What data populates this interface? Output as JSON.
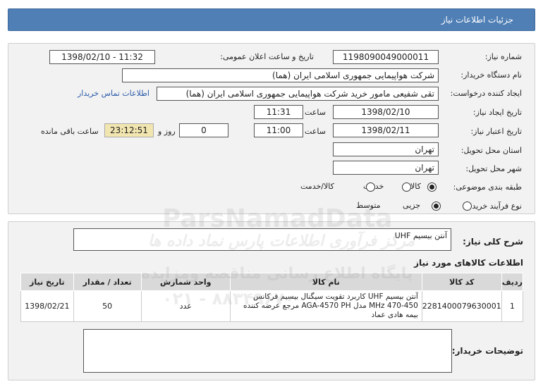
{
  "header": {
    "title": "جزئیات اطلاعات نیاز"
  },
  "form": {
    "need_number_label": "شماره نیاز:",
    "need_number": "1198090049000011",
    "announce_label": "تاریخ و ساعت اعلان عمومی:",
    "announce_value": "1398/02/10 - 11:32",
    "buyer_org_label": "نام دستگاه خریدار:",
    "buyer_org": "شرکت هواپیمایی جمهوری اسلامی ایران (هما)",
    "requester_label": "ایجاد کننده درخواست:",
    "requester": "تقی  شفیعی مامور خرید شرکت هواپیمایی جمهوری اسلامی ایران (هما)",
    "contact_link": "اطلاعات تماس خریدار",
    "create_date_label": "تاریخ ایجاد نیاز:",
    "create_date": "1398/02/10",
    "time_label": "ساعت",
    "create_time": "11:31",
    "valid_date_label": "تاریخ اعتبار نیاز:",
    "valid_date": "1398/02/11",
    "valid_time": "11:00",
    "days_label": "روز و",
    "days_value": "0",
    "remaining_time": "23:12:51",
    "remaining_label": "ساعت باقی مانده",
    "province_label": "استان محل تحویل:",
    "province": "تهران",
    "city_label": "شهر محل تحویل:",
    "city": "تهران",
    "category_label": "طبقه بندی موضوعی:",
    "category_options": [
      "کالا",
      "خدمت",
      "کالا/خدمت"
    ],
    "category_selected": "کالا",
    "process_label": "نوع فرآیند خرید :",
    "process_options": [
      "جزیی",
      "متوسط"
    ],
    "process_selected": "متوسط"
  },
  "summary": {
    "label": "شرح کلی نیاز:",
    "value": "آنتن بیسیم UHF"
  },
  "items": {
    "section_title": "اطلاعات کالاهای مورد نیاز",
    "columns": [
      "ردیف",
      "کد کالا",
      "نام کالا",
      "واحد شمارش",
      "تعداد / مقدار",
      "تاریخ نیاز"
    ],
    "rows": [
      {
        "row": "1",
        "code": "2281400079630001",
        "name": "آنتن بیسیم UHF کاربرد تقویت سیگنال بیسیم فرکانس 450-470 MHz مدل AGA-4570 PH مرجع عرضه کننده بیمه هادی عماد",
        "unit": "عدد",
        "qty": "50",
        "date": "1398/02/21"
      }
    ]
  },
  "buyer_notes": {
    "label": "توضیحات خریدار:",
    "value": ""
  },
  "watermark": {
    "line1": "ParsNamadData",
    "line2": "مرکز فرآوری اطلاعات پارس نماد داده ها",
    "line3": "پایگاه اطلاع رسانی مناقصه ومزایده",
    "line4": "۰۲۱ - ۸۸۳۴۹۶۷۰"
  }
}
